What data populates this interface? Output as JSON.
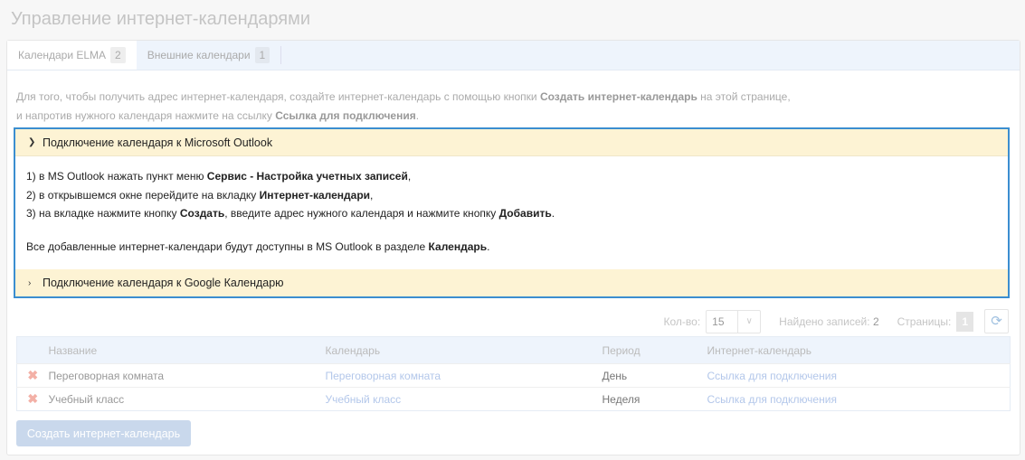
{
  "title": "Управление интернет-календарями",
  "tabs": [
    {
      "label": "Календари ELMA",
      "count": "2"
    },
    {
      "label": "Внешние календари",
      "count": "1"
    }
  ],
  "info": {
    "l1a": "Для того, чтобы получить адрес интернет-календаря, создайте интернет-календарь с помощью кнопки ",
    "l1b": "Создать интернет-календарь",
    "l1c": " на этой странице,",
    "l2a": "и напротив нужного календаря нажмите на ссылку ",
    "l2b": "Ссылка для подключения",
    "l2c": "."
  },
  "accordion": {
    "outlook_title": "Подключение календаря к Microsoft Outlook",
    "steps": [
      {
        "a": "1) в MS Outlook нажать пункт меню ",
        "b": "Сервис - Настройка учетных записей",
        "c": ",",
        "d": "",
        "e": ""
      },
      {
        "a": "2) в открывшемся окне перейдите на вкладку ",
        "b": "Интернет-календари",
        "c": ",",
        "d": "",
        "e": ""
      },
      {
        "a": "3) на вкладке нажмите кнопку ",
        "b": "Создать",
        "c": ", введите адрес нужного календаря и нажмите кнопку ",
        "d": "Добавить",
        "e": "."
      }
    ],
    "note_a": "Все добавленные интернет-календари будут доступны в MS Outlook в разделе ",
    "note_b": "Календарь",
    "note_c": ".",
    "google_title": "Подключение календаря к Google Календарю"
  },
  "pager": {
    "count_label": "Кол-во:",
    "count_value": "15",
    "found_label": "Найдено записей:",
    "found_value": "2",
    "pages_label": "Страницы:",
    "page": "1"
  },
  "table": {
    "headers": [
      "Название",
      "Календарь",
      "Период",
      "Интернет-календарь"
    ],
    "rows": [
      {
        "name": "Переговорная комната",
        "calendar": "Переговорная комната",
        "period": "День",
        "link": "Ссылка для подключения"
      },
      {
        "name": "Учебный класс",
        "calendar": "Учебный класс",
        "period": "Неделя",
        "link": "Ссылка для подключения"
      }
    ]
  },
  "create_button": "Создать интернет-календарь"
}
